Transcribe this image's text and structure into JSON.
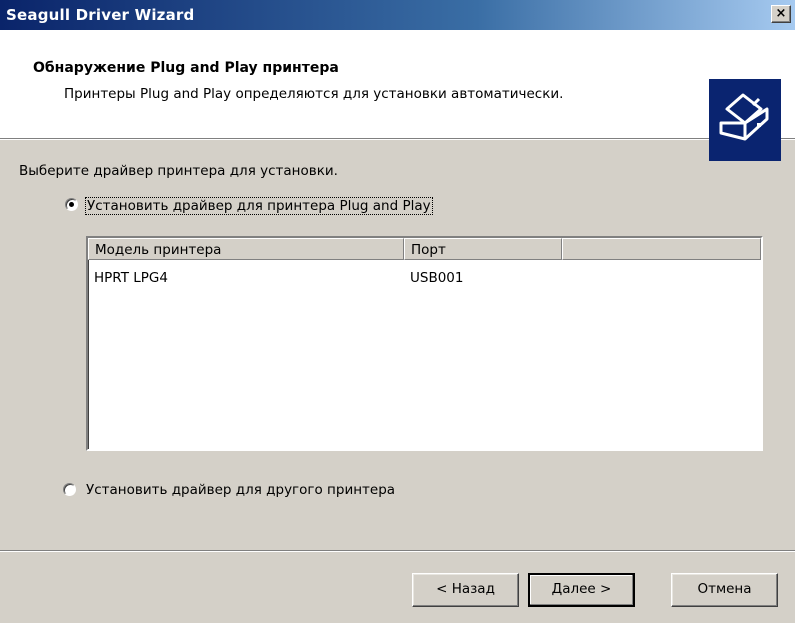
{
  "window": {
    "title": "Seagull Driver Wizard",
    "close_label": "×"
  },
  "header": {
    "title": "Обнаружение Plug and Play принтера",
    "subtitle": "Принтеры Plug and Play определяются для установки автоматически.",
    "icon": "printer-icon"
  },
  "content": {
    "prompt": "Выберите драйвер принтера для установки.",
    "options": [
      {
        "label": "Установить драйвер для принтера Plug and Play",
        "selected": true
      },
      {
        "label": "Установить драйвер для другого принтера",
        "selected": false
      }
    ]
  },
  "list": {
    "columns": [
      "Модель принтера",
      "Порт",
      ""
    ],
    "rows": [
      {
        "model": "HPRT LPG4",
        "port": "USB001"
      }
    ]
  },
  "buttons": {
    "back": "< Назад",
    "next": "Далее >",
    "cancel": "Отмена"
  },
  "colors": {
    "title_bar": "#0a246a",
    "face": "#d4d0c8",
    "icon_bg": "#0a2470"
  }
}
